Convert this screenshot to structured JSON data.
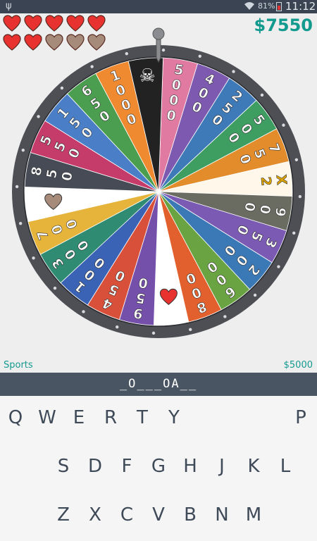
{
  "status_bar": {
    "usb_icon": "usb-icon",
    "wifi_icon": "wifi-icon",
    "battery_percent": "81%",
    "time": "11:12"
  },
  "lives": {
    "total": 10,
    "remaining": 7,
    "full_color": "#e8322f",
    "empty_color": "#a68b7b"
  },
  "money": "$7550",
  "wheel": {
    "segments": [
      {
        "label": "5000",
        "color": "#e07aa0"
      },
      {
        "label": "400",
        "color": "#7d5ab0"
      },
      {
        "label": "250",
        "color": "#3e79b8"
      },
      {
        "label": "500",
        "color": "#3e9e62"
      },
      {
        "label": "750",
        "color": "#e38c2c"
      },
      {
        "label": "X2",
        "color": "#fff7ea",
        "special": "bow"
      },
      {
        "label": "900",
        "color": "#6a6c62"
      },
      {
        "label": "350",
        "color": "#7a5ab2"
      },
      {
        "label": "200",
        "color": "#3b78b6"
      },
      {
        "label": "600",
        "color": "#6aa342"
      },
      {
        "label": "800",
        "color": "#e2602d"
      },
      {
        "label": "",
        "color": "#ffffff",
        "special": "heart"
      },
      {
        "label": "950",
        "color": "#7450ab"
      },
      {
        "label": "450",
        "color": "#d84f3a"
      },
      {
        "label": "100",
        "color": "#3a63b5"
      },
      {
        "label": "300",
        "color": "#2f8c72"
      },
      {
        "label": "700",
        "color": "#e6b43a"
      },
      {
        "label": "",
        "color": "#ffffff",
        "special": "heart-grey"
      },
      {
        "label": "850",
        "color": "#464b55"
      },
      {
        "label": "550",
        "color": "#c53c6a"
      },
      {
        "label": "150",
        "color": "#4a7fc7"
      },
      {
        "label": "650",
        "color": "#4b9e4f"
      },
      {
        "label": "1000",
        "color": "#f08a30"
      },
      {
        "label": "",
        "color": "#222222",
        "special": "skull"
      }
    ],
    "rim_color": "#4d4f55"
  },
  "category": "Sports",
  "prize": "$5000",
  "puzzle": "_O___OA__",
  "keyboard": {
    "row1": [
      "Q",
      "W",
      "E",
      "R",
      "T",
      "Y",
      "",
      "",
      "",
      "P"
    ],
    "row2": [
      "",
      "S",
      "D",
      "F",
      "G",
      "H",
      "J",
      "K",
      "L"
    ],
    "row3": [
      "",
      "Z",
      "X",
      "C",
      "V",
      "B",
      "N",
      "M"
    ]
  }
}
